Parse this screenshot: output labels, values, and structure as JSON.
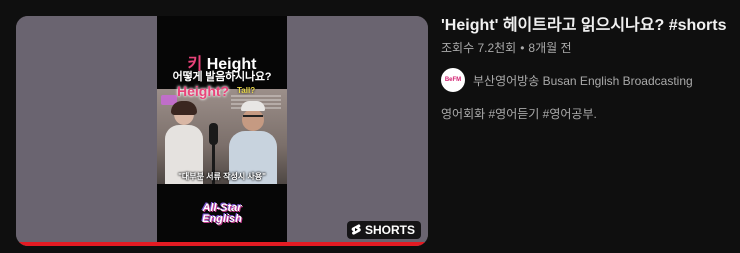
{
  "video": {
    "title": "'Height' 헤이트라고 읽으시나요? #shorts",
    "views": "조회수 7.2천회",
    "separator": "•",
    "age": "8개월 전",
    "badge_label": "SHORTS",
    "description": "영어회화 #영어듣기 #영어공부."
  },
  "channel": {
    "name": "부산영어방송 Busan English Broadcasting",
    "avatar_text": "BeFM"
  },
  "thumbnail": {
    "title_prefix": "키",
    "title_word": "Height",
    "subtitle": "어떻게 발음하시나요?",
    "overlay_word": "Height?",
    "overlay_tall": "Tall?",
    "caption": "\"대부분 서류 작성시 사용\"",
    "brand_line1": "All-Star",
    "brand_line2": "English",
    "progress": 1.0
  },
  "colors": {
    "background": "#0f0f0f",
    "accent_pink": "#e9437a",
    "progress_red": "#e31b23",
    "text_secondary": "#aaaaaa"
  },
  "icons": {
    "shorts": "shorts-icon"
  }
}
